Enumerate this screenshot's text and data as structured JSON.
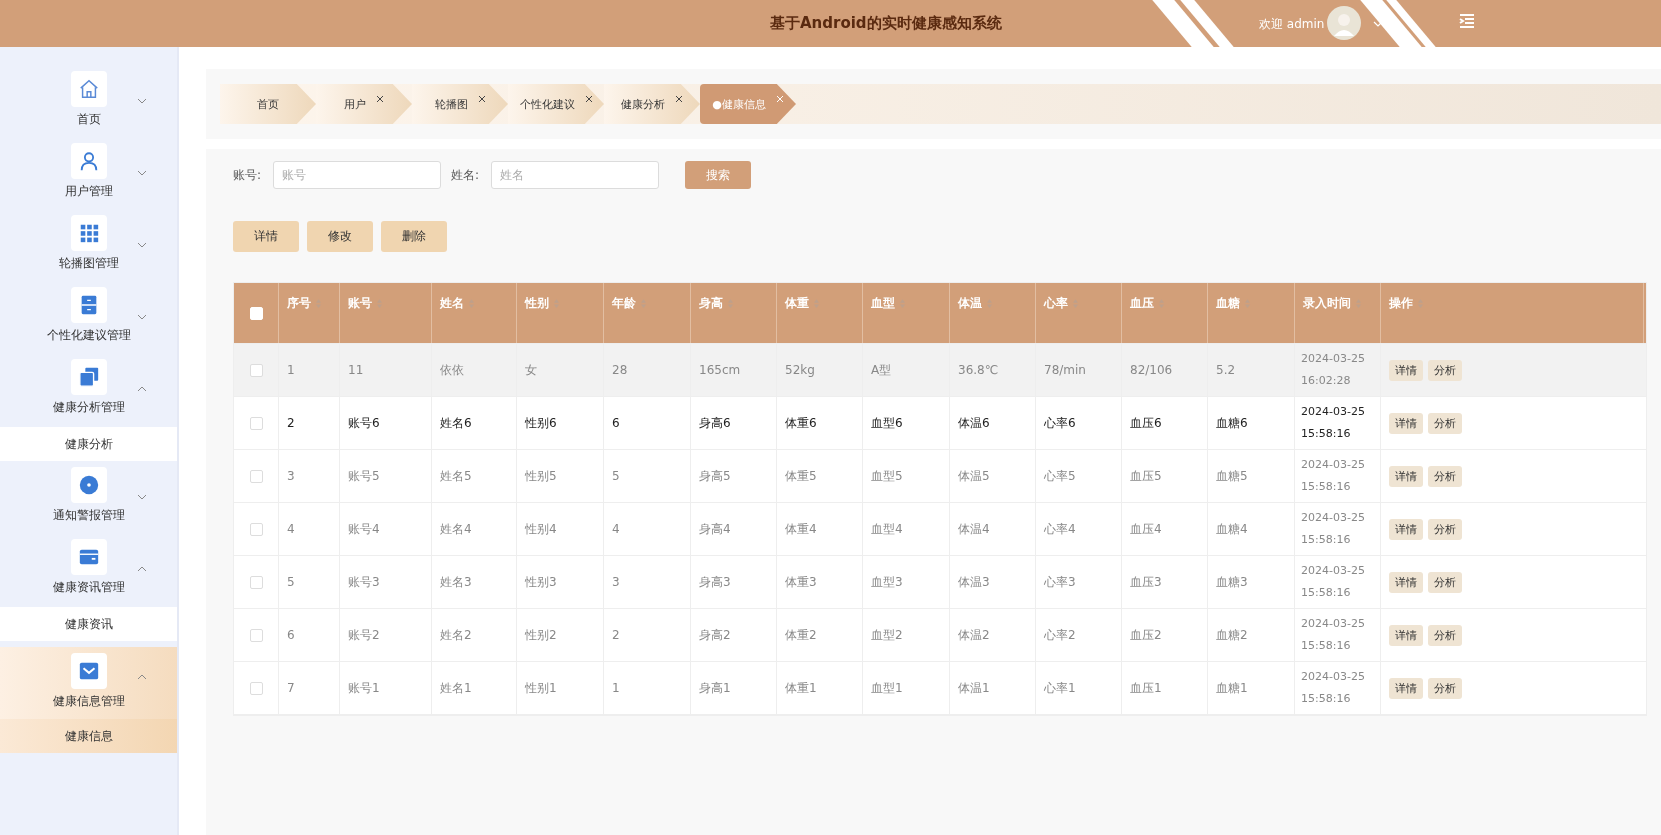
{
  "header": {
    "title": "基于Android的实时健康感知系统",
    "greeting": "欢迎 admin"
  },
  "sidebar": {
    "items": [
      {
        "label": "首页",
        "expanded": false,
        "active": false
      },
      {
        "label": "用户管理",
        "expanded": false,
        "active": false
      },
      {
        "label": "轮播图管理",
        "expanded": false,
        "active": false
      },
      {
        "label": "个性化建议管理",
        "expanded": false,
        "active": false
      },
      {
        "label": "健康分析管理",
        "expanded": true,
        "active": false,
        "children": [
          {
            "label": "健康分析",
            "selected": false
          }
        ]
      },
      {
        "label": "通知警报管理",
        "expanded": false,
        "active": false
      },
      {
        "label": "健康资讯管理",
        "expanded": true,
        "active": false,
        "children": [
          {
            "label": "健康资讯",
            "selected": false
          }
        ]
      },
      {
        "label": "健康信息管理",
        "expanded": true,
        "active": true,
        "children": [
          {
            "label": "健康信息",
            "selected": true
          }
        ]
      }
    ]
  },
  "tabs": [
    {
      "label": "首页",
      "closable": false,
      "selected": false
    },
    {
      "label": "用户",
      "closable": true,
      "selected": false
    },
    {
      "label": "轮播图",
      "closable": true,
      "selected": false
    },
    {
      "label": "个性化建议",
      "closable": true,
      "selected": false
    },
    {
      "label": "健康分析",
      "closable": true,
      "selected": false
    },
    {
      "label": "●健康信息",
      "closable": true,
      "selected": true
    }
  ],
  "search": {
    "fields": [
      {
        "label": "账号:",
        "placeholder": "账号"
      },
      {
        "label": "姓名:",
        "placeholder": "姓名"
      }
    ],
    "button": "搜索"
  },
  "actions": [
    "详情",
    "修改",
    "删除"
  ],
  "table": {
    "columns": [
      {
        "label": "序号"
      },
      {
        "label": "账号"
      },
      {
        "label": "姓名"
      },
      {
        "label": "性别"
      },
      {
        "label": "年龄"
      },
      {
        "label": "身高"
      },
      {
        "label": "体重"
      },
      {
        "label": "血型"
      },
      {
        "label": "体温"
      },
      {
        "label": "心率"
      },
      {
        "label": "血压"
      },
      {
        "label": "血糖"
      },
      {
        "label": "录入时间"
      },
      {
        "label": "操作"
      }
    ],
    "header_checked": false,
    "rows": [
      {
        "checked": false,
        "shaded": true,
        "highlighted": false,
        "cells": [
          "1",
          "11",
          "依依",
          "女",
          "28",
          "165cm",
          "52kg",
          "A型",
          "36.8℃",
          "78/min",
          "82/106",
          "5.2",
          "2024-03-25 16:02:28"
        ],
        "buttons": [
          "详情",
          "分析"
        ]
      },
      {
        "checked": false,
        "shaded": false,
        "highlighted": true,
        "cells": [
          "2",
          "账号6",
          "姓名6",
          "性别6",
          "6",
          "身高6",
          "体重6",
          "血型6",
          "体温6",
          "心率6",
          "血压6",
          "血糖6",
          "2024-03-25 15:58:16"
        ],
        "buttons": [
          "详情",
          "分析"
        ]
      },
      {
        "checked": false,
        "shaded": false,
        "highlighted": false,
        "cells": [
          "3",
          "账号5",
          "姓名5",
          "性别5",
          "5",
          "身高5",
          "体重5",
          "血型5",
          "体温5",
          "心率5",
          "血压5",
          "血糖5",
          "2024-03-25 15:58:16"
        ],
        "buttons": [
          "详情",
          "分析"
        ]
      },
      {
        "checked": false,
        "shaded": false,
        "highlighted": false,
        "cells": [
          "4",
          "账号4",
          "姓名4",
          "性别4",
          "4",
          "身高4",
          "体重4",
          "血型4",
          "体温4",
          "心率4",
          "血压4",
          "血糖4",
          "2024-03-25 15:58:16"
        ],
        "buttons": [
          "详情",
          "分析"
        ]
      },
      {
        "checked": false,
        "shaded": false,
        "highlighted": false,
        "cells": [
          "5",
          "账号3",
          "姓名3",
          "性别3",
          "3",
          "身高3",
          "体重3",
          "血型3",
          "体温3",
          "心率3",
          "血压3",
          "血糖3",
          "2024-03-25 15:58:16"
        ],
        "buttons": [
          "详情",
          "分析"
        ]
      },
      {
        "checked": false,
        "shaded": false,
        "highlighted": false,
        "cells": [
          "6",
          "账号2",
          "姓名2",
          "性别2",
          "2",
          "身高2",
          "体重2",
          "血型2",
          "体温2",
          "心率2",
          "血压2",
          "血糖2",
          "2024-03-25 15:58:16"
        ],
        "buttons": [
          "详情",
          "分析"
        ]
      },
      {
        "checked": false,
        "shaded": false,
        "highlighted": false,
        "cells": [
          "7",
          "账号1",
          "姓名1",
          "性别1",
          "1",
          "身高1",
          "体重1",
          "血型1",
          "体温1",
          "心率1",
          "血压1",
          "血糖1",
          "2024-03-25 15:58:16"
        ],
        "buttons": [
          "详情",
          "分析"
        ]
      }
    ]
  }
}
